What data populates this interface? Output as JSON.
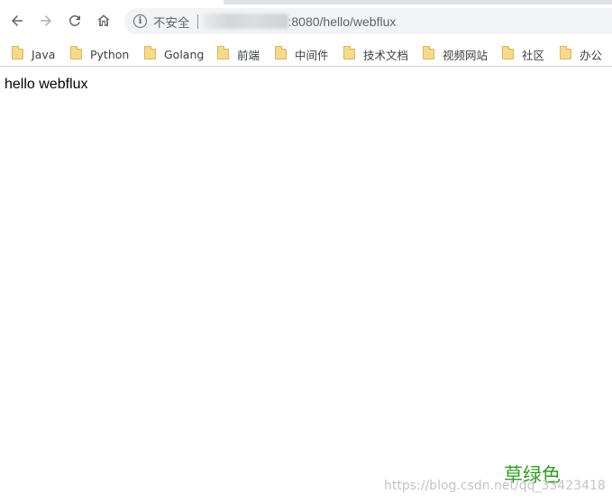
{
  "toolbar": {
    "back_icon": "arrow-left-icon",
    "forward_icon": "arrow-right-icon",
    "reload_icon": "reload-icon",
    "home_icon": "home-icon"
  },
  "omnibox": {
    "security_icon": "info-icon",
    "security_label": "不安全",
    "url": ":8080/hello/webflux"
  },
  "bookmarks": [
    {
      "label": "Java",
      "icon": "folder-icon"
    },
    {
      "label": "Python",
      "icon": "folder-icon"
    },
    {
      "label": "Golang",
      "icon": "folder-icon"
    },
    {
      "label": "前端",
      "icon": "folder-icon"
    },
    {
      "label": "中间件",
      "icon": "folder-icon"
    },
    {
      "label": "技术文档",
      "icon": "folder-icon"
    },
    {
      "label": "视频网站",
      "icon": "folder-icon"
    },
    {
      "label": "社区",
      "icon": "folder-icon"
    },
    {
      "label": "办公",
      "icon": "folder-icon"
    }
  ],
  "page": {
    "body_text": "hello webflux"
  },
  "watermark": {
    "title": "草绿色",
    "url": "https://blog.csdn.net/qq_33423418",
    "title_color": "#2e9e24"
  }
}
